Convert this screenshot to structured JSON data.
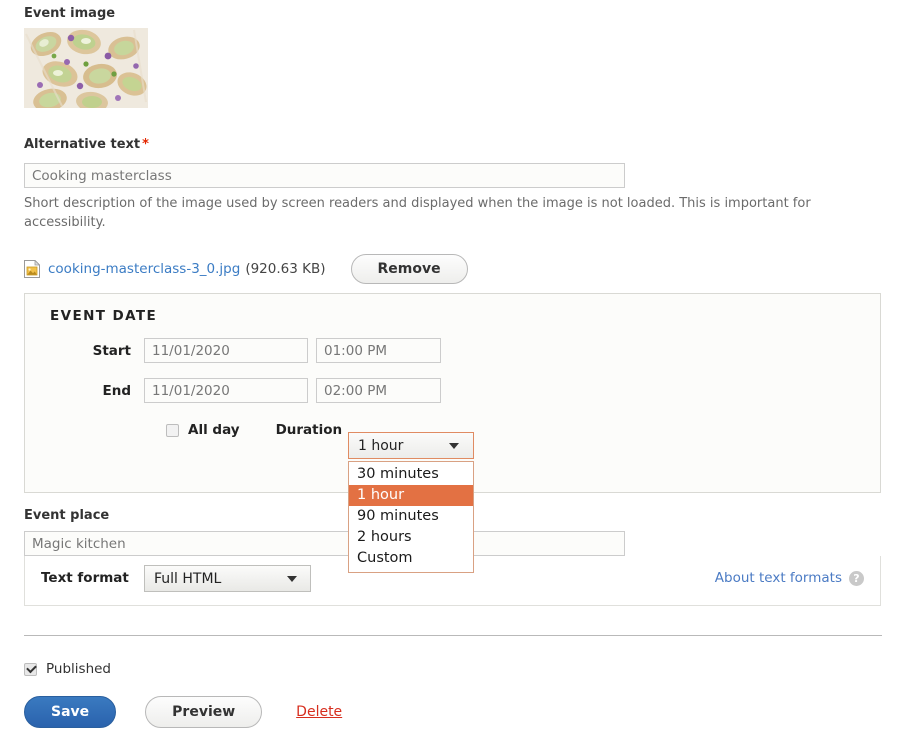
{
  "image_field": {
    "label": "Event image",
    "thumbnail_alt": "food-photo-thumbnail"
  },
  "alt_text_field": {
    "label": "Alternative text",
    "required_marker": "*",
    "value": "Cooking masterclass",
    "description": "Short description of the image used by screen readers and displayed when the image is not loaded. This is important for accessibility."
  },
  "file_row": {
    "icon": "image-file-icon",
    "filename": "cooking-masterclass-3_0.jpg",
    "filesize": "(920.63 KB)",
    "remove_label": "Remove"
  },
  "event_date": {
    "legend": "EVENT DATE",
    "start_label": "Start",
    "start_date": "11/01/2020",
    "start_time": "01:00 PM",
    "end_label": "End",
    "end_date": "11/01/2020",
    "end_time": "02:00 PM",
    "all_day_label": "All day",
    "all_day_checked": false,
    "duration_label": "Duration",
    "duration_value": "1 hour",
    "duration_options": [
      "30 minutes",
      "1 hour",
      "90 minutes",
      "2 hours",
      "Custom"
    ],
    "duration_selected_index": 1,
    "highlight_color": "#e37143",
    "focus_border_color": "#e08b62"
  },
  "event_place": {
    "label": "Event place",
    "value": "Magic kitchen",
    "text_format_label": "Text format",
    "text_format_value": "Full HTML",
    "about_text_formats": "About text formats",
    "help_icon": "question-mark-icon"
  },
  "footer": {
    "published_label": "Published",
    "published_checked": true,
    "save_label": "Save",
    "preview_label": "Preview",
    "delete_label": "Delete",
    "save_color": "#2a62ad",
    "delete_color": "#d72e1e"
  }
}
